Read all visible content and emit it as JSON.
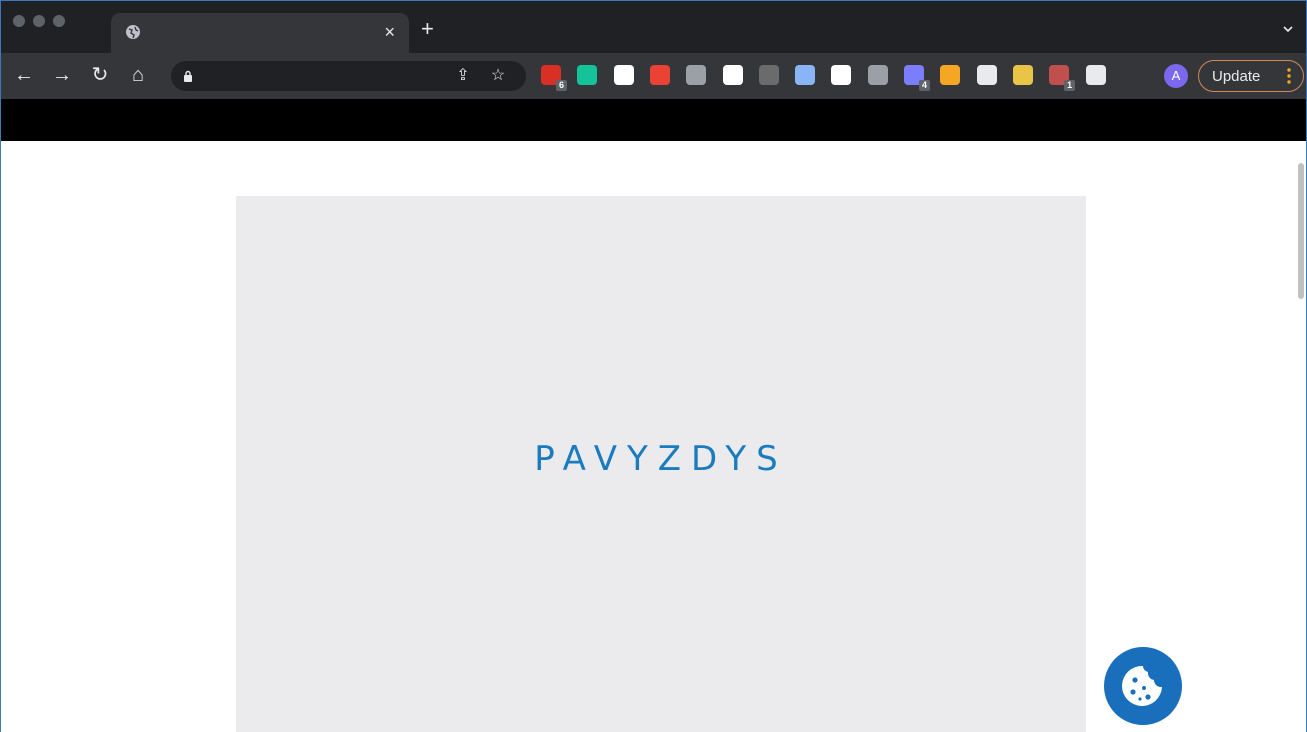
{
  "browser": {
    "tab": {
      "title": ""
    },
    "toolbar": {
      "update_label": "Update",
      "avatar_initial": "A"
    },
    "extensions": [
      {
        "name": "calendar-extension-icon",
        "color": "#d93025",
        "badge": "6"
      },
      {
        "name": "grammarly-extension-icon",
        "color": "#15c39a",
        "badge": ""
      },
      {
        "name": "ghost-extension-icon",
        "color": "#ffffff",
        "badge": ""
      },
      {
        "name": "stop-extension-icon",
        "color": "#ea4335",
        "badge": ""
      },
      {
        "name": "leaf-extension-icon",
        "color": "#9aa0a6",
        "badge": ""
      },
      {
        "name": "back-arrow-extension-icon",
        "color": "#ffffff",
        "badge": ""
      },
      {
        "name": "arrow-extension-icon",
        "color": "#6b6b6b",
        "badge": ""
      },
      {
        "name": "li-extension-icon",
        "color": "#8ab4f8",
        "badge": ""
      },
      {
        "name": "screen-extension-icon",
        "color": "#ffffff",
        "badge": ""
      },
      {
        "name": "w-extension-icon",
        "color": "#9aa0a6",
        "badge": ""
      },
      {
        "name": "sparkle-extension-icon",
        "color": "#7c7cff",
        "badge": "4"
      },
      {
        "name": "tower-extension-icon",
        "color": "#f5a623",
        "badge": ""
      },
      {
        "name": "tag-extension-icon",
        "color": "#e8eaed",
        "badge": ""
      },
      {
        "name": "grid-extension-icon",
        "color": "#e8c547",
        "badge": ""
      },
      {
        "name": "ud-extension-icon",
        "color": "#c0504d",
        "badge": "1"
      },
      {
        "name": "puzzle-extension-icon",
        "color": "#e8eaed",
        "badge": ""
      }
    ]
  },
  "page": {
    "hero_text": "PAVYZDYS",
    "accent_color": "#1a7bbf",
    "cookie_button_color": "#1a6fbd"
  }
}
